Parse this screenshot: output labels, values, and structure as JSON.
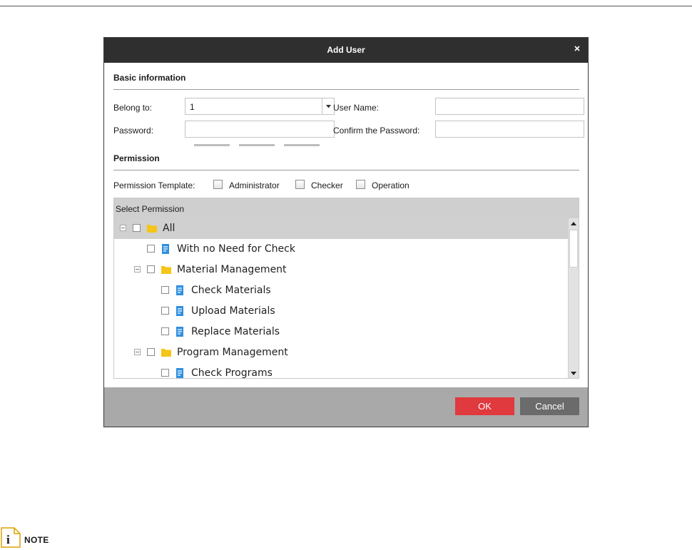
{
  "dialog": {
    "title": "Add User",
    "close_glyph": "×",
    "basic_section": "Basic information",
    "belong_to_label": "Belong to:",
    "belong_to_value": "1",
    "user_name_label": "User Name:",
    "user_name_value": "",
    "password_label": "Password:",
    "password_value": "",
    "confirm_label": "Confirm the Password:",
    "confirm_value": "",
    "permission_section": "Permission",
    "template_label": "Permission Template:",
    "templates": [
      "Administrator",
      "Checker",
      "Operation"
    ],
    "select_permission_header": "Select Permission",
    "tree": [
      {
        "label": "All",
        "type": "folder",
        "level": 0,
        "expanded": true,
        "selected": true
      },
      {
        "label": "With no Need for Check",
        "type": "item",
        "level": 1
      },
      {
        "label": "Material Management",
        "type": "folder",
        "level": 1,
        "expanded": true
      },
      {
        "label": "Check Materials",
        "type": "item",
        "level": 2
      },
      {
        "label": "Upload Materials",
        "type": "item",
        "level": 2
      },
      {
        "label": "Replace Materials",
        "type": "item",
        "level": 2
      },
      {
        "label": "Program Management",
        "type": "folder",
        "level": 1,
        "expanded": true
      },
      {
        "label": "Check Programs",
        "type": "item",
        "level": 2
      }
    ],
    "ok_label": "OK",
    "cancel_label": "Cancel"
  },
  "note": {
    "label": "NOTE",
    "icon": "info-icon"
  },
  "colors": {
    "titlebar": "#2f2f2f",
    "ok": "#e0393e",
    "cancel": "#6b6b6b",
    "folder": "#f5c518",
    "doc": "#2f8fe0"
  }
}
